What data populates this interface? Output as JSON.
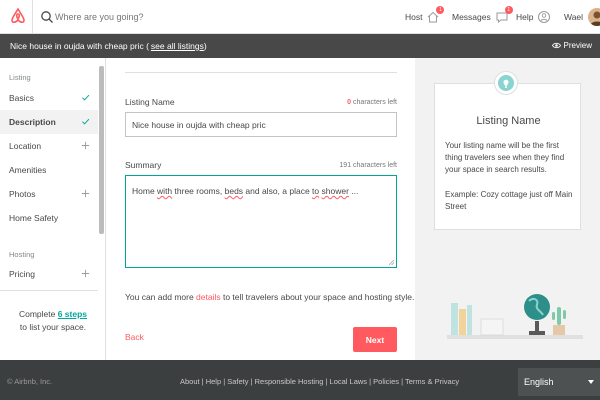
{
  "header": {
    "search_placeholder": "Where are you going?",
    "host_label": "Host",
    "host_badge": "1",
    "messages_label": "Messages",
    "messages_badge": "1",
    "help_label": "Help",
    "user_name": "Wael"
  },
  "listing_bar": {
    "title": "Nice house in oujda with cheap pric",
    "see_all": "see all listings",
    "preview": "Preview"
  },
  "sidebar": {
    "listing_section": "Listing",
    "hosting_section": "Hosting",
    "items": [
      {
        "label": "Basics",
        "status": "check"
      },
      {
        "label": "Description",
        "status": "check"
      },
      {
        "label": "Location",
        "status": "plus"
      },
      {
        "label": "Amenities",
        "status": ""
      },
      {
        "label": "Photos",
        "status": "plus"
      },
      {
        "label": "Home Safety",
        "status": ""
      },
      {
        "label": "Pricing",
        "status": "plus"
      }
    ],
    "complete_prefix": "Complete ",
    "complete_link": "6 steps",
    "complete_suffix": "to list your space."
  },
  "form": {
    "name_label": "Listing Name",
    "name_chars_count": "0",
    "name_chars_suffix": "characters left",
    "name_value": "Nice house in oujda with cheap pric",
    "summary_label": "Summary",
    "summary_chars": "191 characters left",
    "summary_parts": [
      "Home ",
      "with",
      " three rooms, ",
      "beds",
      " and also, a place ",
      "to",
      " ",
      "shower",
      " ..."
    ],
    "more_prefix": "You can add more ",
    "more_link": "details",
    "more_suffix": " to tell travelers about your space and hosting style.",
    "back_label": "Back",
    "next_label": "Next"
  },
  "tip": {
    "title": "Listing Name",
    "body": "Your listing name will be the first thing travelers see when they find your space in search results.",
    "example": "Example: Cozy cottage just off Main Street"
  },
  "footer": {
    "copyright": "© Airbnb, Inc.",
    "links": "About | Help | Safety | Responsible Hosting | Local Laws | Policies | Terms & Privacy",
    "language": "English"
  },
  "colors": {
    "brand": "#ff5a5f",
    "teal": "#00a699",
    "dark": "#484848",
    "footer": "#3c3f40"
  }
}
